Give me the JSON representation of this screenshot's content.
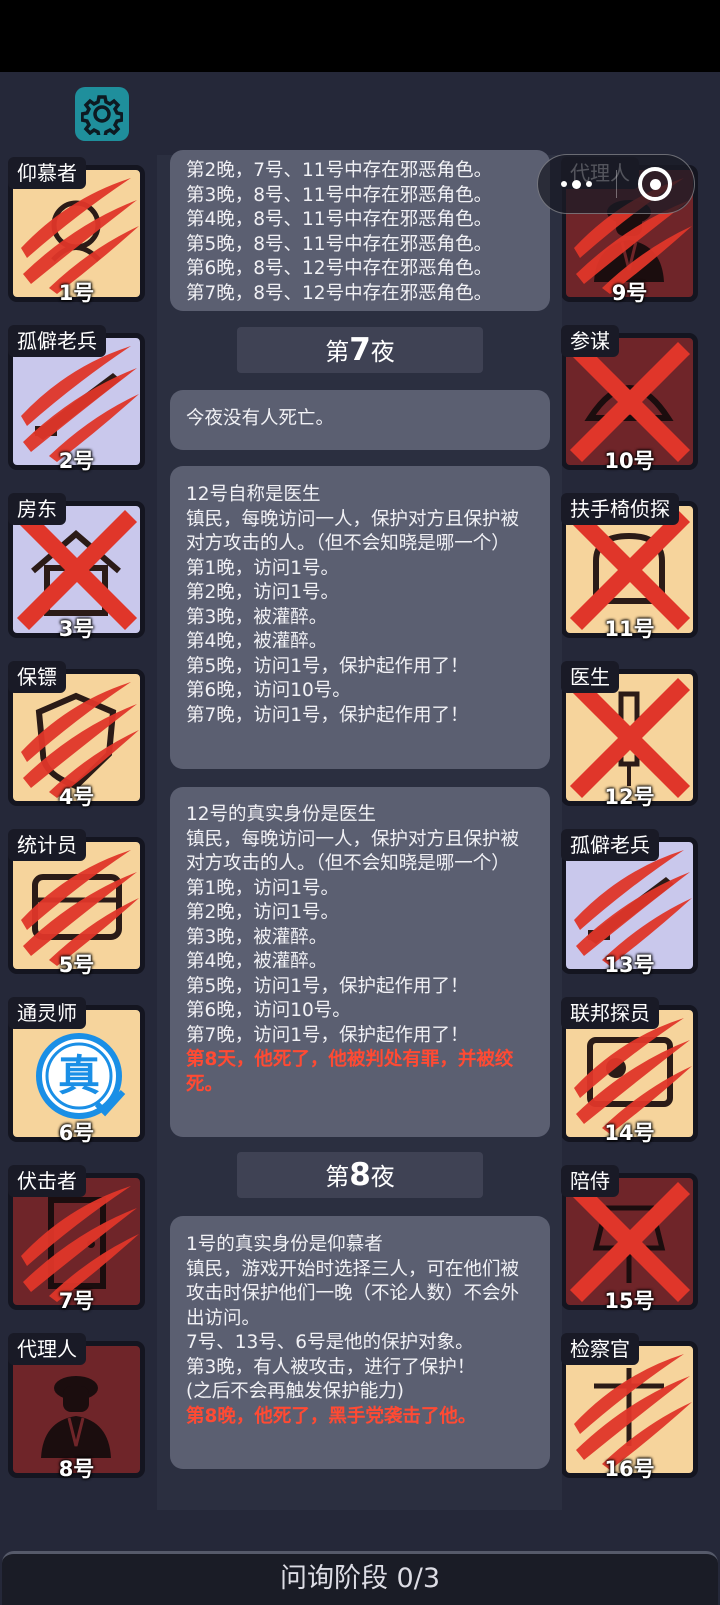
{
  "top_bar": {
    "settings_icon": "gear-icon",
    "more_icon": "more-dots-icon",
    "close_icon": "mini-program-close-icon"
  },
  "colors": {
    "background": "#252839",
    "card_peach": "#f6d49c",
    "card_lavender": "#c9c8ec",
    "card_red": "#6f2529",
    "scratch": "#e0362a",
    "settings": "#1f8f9c"
  },
  "players_left": [
    {
      "role": "仰慕者",
      "number": "1号",
      "bg": "peach",
      "status": "scratched",
      "icon": "admirer-icon"
    },
    {
      "role": "孤僻老兵",
      "number": "2号",
      "bg": "lavender",
      "status": "scratched",
      "icon": "rifle-icon"
    },
    {
      "role": "房东",
      "number": "3号",
      "bg": "lavender",
      "status": "crossed",
      "icon": "house-icon"
    },
    {
      "role": "保镖",
      "number": "4号",
      "bg": "peach",
      "status": "scratched",
      "icon": "shield-icon"
    },
    {
      "role": "统计员",
      "number": "5号",
      "bg": "peach",
      "status": "scratched",
      "icon": "abacus-icon"
    },
    {
      "role": "通灵师",
      "number": "6号",
      "bg": "peach",
      "status": "verified",
      "icon": "medium-icon",
      "badge": "真"
    },
    {
      "role": "伏击者",
      "number": "7号",
      "bg": "red",
      "status": "scratched",
      "icon": "door-icon"
    },
    {
      "role": "代理人",
      "number": "8号",
      "bg": "red",
      "status": "alive",
      "icon": "suit-man-icon"
    }
  ],
  "players_right": [
    {
      "role": "代理人",
      "number": "9号",
      "bg": "red",
      "status": "scratched",
      "icon": "suit-man-icon"
    },
    {
      "role": "参谋",
      "number": "10号",
      "bg": "red",
      "status": "crossed",
      "icon": "cap-icon"
    },
    {
      "role": "扶手椅侦探",
      "number": "11号",
      "bg": "peach",
      "status": "crossed",
      "icon": "armchair-icon"
    },
    {
      "role": "医生",
      "number": "12号",
      "bg": "peach",
      "status": "crossed",
      "icon": "syringe-icon"
    },
    {
      "role": "孤僻老兵",
      "number": "13号",
      "bg": "lavender",
      "status": "scratched",
      "icon": "rifle-icon"
    },
    {
      "role": "联邦探员",
      "number": "14号",
      "bg": "peach",
      "status": "scratched",
      "icon": "badge-card-icon"
    },
    {
      "role": "陪侍",
      "number": "15号",
      "bg": "red",
      "status": "crossed",
      "icon": "lamp-icon"
    },
    {
      "role": "检察官",
      "number": "16号",
      "bg": "peach",
      "status": "scratched",
      "icon": "scales-icon"
    }
  ],
  "log": {
    "card1_lines": "第2晚，7号、11号中存在邪恶角色。\n第3晚，8号、11号中存在邪恶角色。\n第4晚，8号、11号中存在邪恶角色。\n第5晚，8号、11号中存在邪恶角色。\n第6晚，8号、12号中存在邪恶角色。\n第7晚，8号、12号中存在邪恶角色。",
    "night7": {
      "prefix": "第",
      "num": "7",
      "suffix": "夜"
    },
    "card2": "今夜没有人死亡。",
    "card3": "12号自称是医生\n镇民，每晚访问一人，保护对方且保护被对方攻击的人。（但不会知晓是哪一个）\n第1晚，访问1号。\n第2晚，访问1号。\n第3晚，被灌醉。\n第4晚，被灌醉。\n第5晚，访问1号，保护起作用了！\n第6晚，访问10号。\n第7晚，访问1号，保护起作用了！",
    "card4": "12号的真实身份是医生\n镇民，每晚访问一人，保护对方且保护被对方攻击的人。（但不会知晓是哪一个）\n第1晚，访问1号。\n第2晚，访问1号。\n第3晚，被灌醉。\n第4晚，被灌醉。\n第5晚，访问1号，保护起作用了！\n第6晚，访问10号。\n第7晚，访问1号，保护起作用了！",
    "card4_red": "第8天，他死了，他被判处有罪，并被绞死。",
    "night8": {
      "prefix": "第",
      "num": "8",
      "suffix": "夜"
    },
    "card5": "1号的真实身份是仰慕者\n镇民，游戏开始时选择三人，可在他们被攻击时保护他们一晚（不论人数）不会外出访问。\n7号、13号、6号是他的保护对象。\n第3晚，有人被攻击，进行了保护！\n(之后不会再触发保护能力)",
    "card5_red": "第8晚，他死了，黑手党袭击了他。"
  },
  "phase": "问询阶段 0/3"
}
